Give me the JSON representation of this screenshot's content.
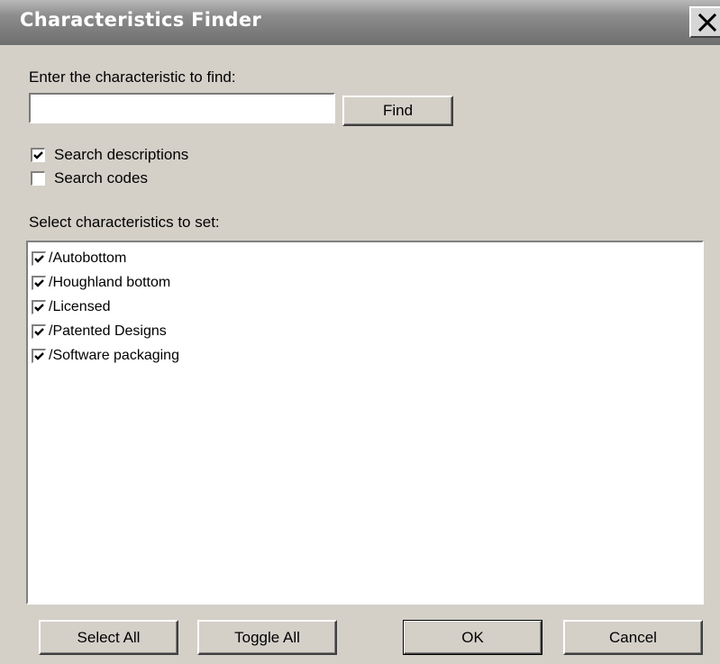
{
  "window": {
    "title": "Characteristics Finder"
  },
  "search": {
    "prompt_label": "Enter the characteristic to find:",
    "input_value": "",
    "placeholder": "",
    "find_label": "Find"
  },
  "options": {
    "search_descriptions": {
      "label": "Search descriptions",
      "checked": true
    },
    "search_codes": {
      "label": "Search codes",
      "checked": false
    }
  },
  "characteristics": {
    "section_label": "Select characteristics to set:",
    "items": [
      {
        "label": "/Autobottom",
        "checked": true
      },
      {
        "label": "/Houghland bottom",
        "checked": true
      },
      {
        "label": "/Licensed",
        "checked": true
      },
      {
        "label": "/Patented Designs",
        "checked": true
      },
      {
        "label": "/Software packaging",
        "checked": true
      }
    ]
  },
  "buttons": {
    "select_all": "Select All",
    "toggle_all": "Toggle All",
    "ok": "OK",
    "cancel": "Cancel"
  },
  "icons": {
    "close": "close-icon",
    "check": "checkmark-icon"
  },
  "colors": {
    "titlebar_top": "#b9b9b9",
    "titlebar_bottom": "#6e6e6e",
    "dialog_face": "#d4d0c8"
  }
}
